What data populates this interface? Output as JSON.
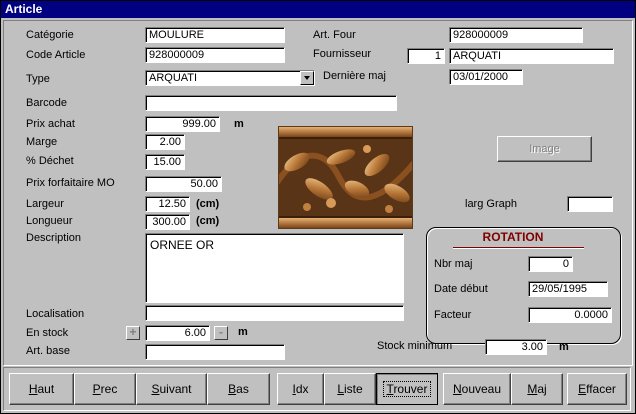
{
  "window": {
    "title": "Article"
  },
  "labels": {
    "categorie": "Catégorie",
    "code_article": "Code Article",
    "type": "Type",
    "barcode": "Barcode",
    "prix_achat": "Prix achat",
    "marge": "Marge",
    "dechet": "% Déchet",
    "prix_forfaitaire": "Prix forfaitaire MO",
    "largeur": "Largeur",
    "longueur": "Longueur",
    "description": "Description",
    "localisation": "Localisation",
    "en_stock": "En stock",
    "art_base": "Art. base",
    "art_four": "Art. Four",
    "fournisseur": "Fournisseur",
    "derniere_maj": "Dernière maj",
    "larg_graph": "larg Graph",
    "stock_minimum": "Stock minimum",
    "unit_m": "m",
    "unit_cm": "(cm)"
  },
  "fields": {
    "categorie": "MOULURE",
    "code_article": "928000009",
    "type": "ARQUATI",
    "barcode": "",
    "prix_achat": "999.00",
    "marge": "2.00",
    "dechet": "15.00",
    "prix_forfaitaire": "50.00",
    "largeur": "12.50",
    "longueur": "300.00",
    "description": "ORNEE OR",
    "localisation": "",
    "en_stock": "6.00",
    "art_base": "",
    "art_four": "928000009",
    "fournisseur_num": "1",
    "fournisseur_name": "ARQUATI",
    "derniere_maj": "03/01/2000",
    "larg_graph": "",
    "stock_minimum": "3.00"
  },
  "rotation": {
    "title": "ROTATION",
    "nbr_maj_label": "Nbr maj",
    "nbr_maj": "0",
    "date_debut_label": "Date début",
    "date_debut": "29/05/1995",
    "facteur_label": "Facteur",
    "facteur": "0.0000"
  },
  "buttons": {
    "image": "Image",
    "plus": "+",
    "minus": "-"
  },
  "toolbar": [
    {
      "pre": "",
      "ul": "H",
      "post": "aut"
    },
    {
      "pre": "",
      "ul": "P",
      "post": "rec"
    },
    {
      "pre": "",
      "ul": "S",
      "post": "uivant"
    },
    {
      "pre": "",
      "ul": "B",
      "post": "as"
    },
    {
      "pre": "",
      "ul": "I",
      "post": "dx"
    },
    {
      "pre": "",
      "ul": "L",
      "post": "iste"
    },
    {
      "pre": "",
      "ul": "T",
      "post": "rouver"
    },
    {
      "pre": "",
      "ul": "N",
      "post": "ouveau"
    },
    {
      "pre": "",
      "ul": "M",
      "post": "aj"
    },
    {
      "pre": "",
      "ul": "E",
      "post": "ffacer"
    }
  ],
  "colors": {
    "title_bar": "#000080",
    "rotation_accent": "#800000",
    "face": "#c0c0c0"
  }
}
